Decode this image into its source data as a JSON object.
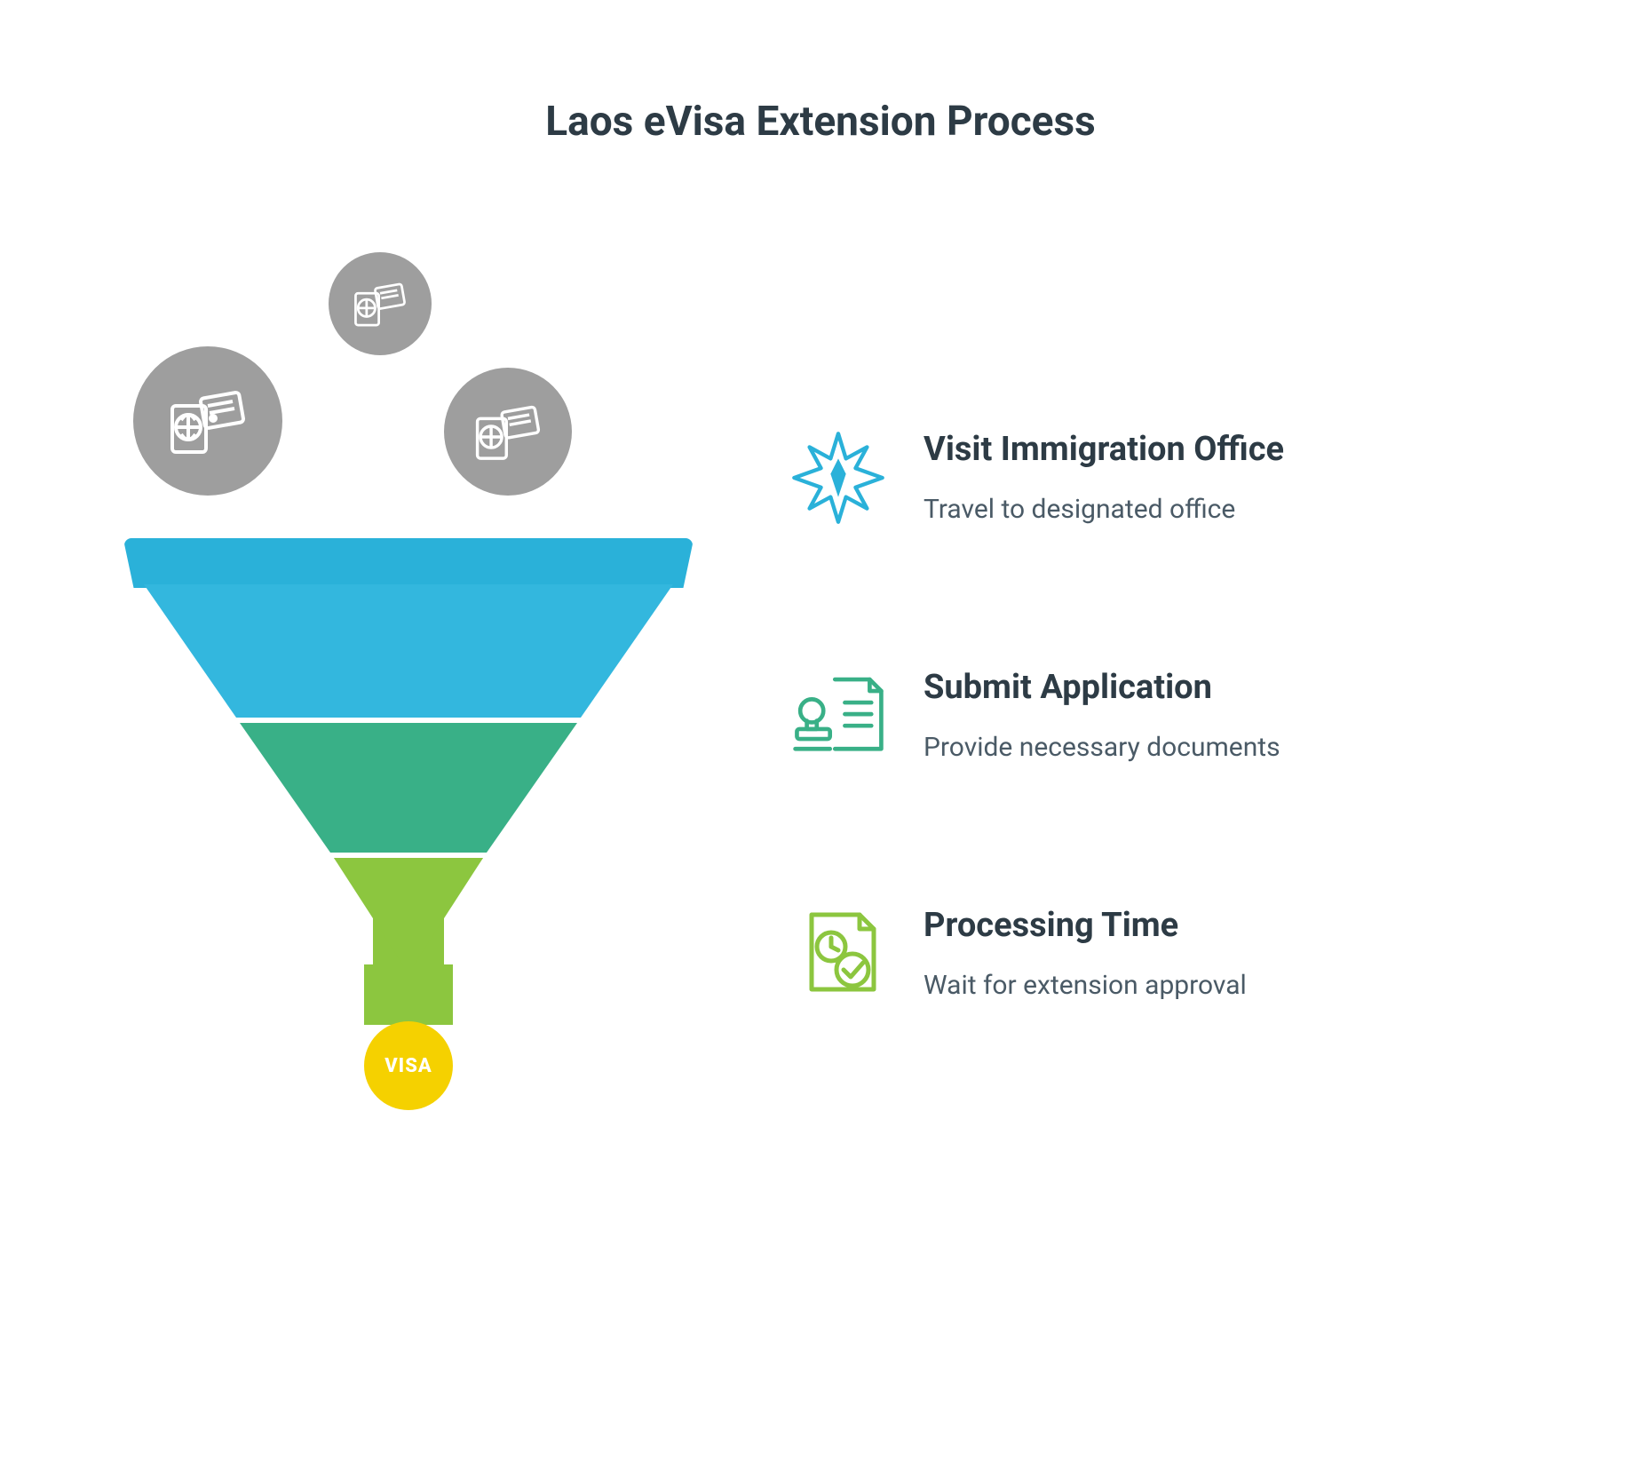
{
  "title": "Laos eVisa Extension Process",
  "output_label": "VISA",
  "colors": {
    "rim": "#2ab1d9",
    "section_top": "#33b7de",
    "section_mid": "#39b087",
    "section_bot": "#8cc63f",
    "circle_gray": "#9e9e9e",
    "visa_yellow": "#f5d100",
    "icon_blue": "#2ab1d9",
    "icon_green": "#39b087",
    "icon_olive": "#8cc63f",
    "text_dark": "#2d3b45",
    "text_muted": "#4a5a66"
  },
  "steps": [
    {
      "icon": "compass-star-icon",
      "title": "Visit Immigration Office",
      "subtitle": "Travel to designated office"
    },
    {
      "icon": "stamp-document-icon",
      "title": "Submit Application",
      "subtitle": "Provide necessary documents"
    },
    {
      "icon": "clock-check-document-icon",
      "title": "Processing Time",
      "subtitle": "Wait for extension approval"
    }
  ]
}
